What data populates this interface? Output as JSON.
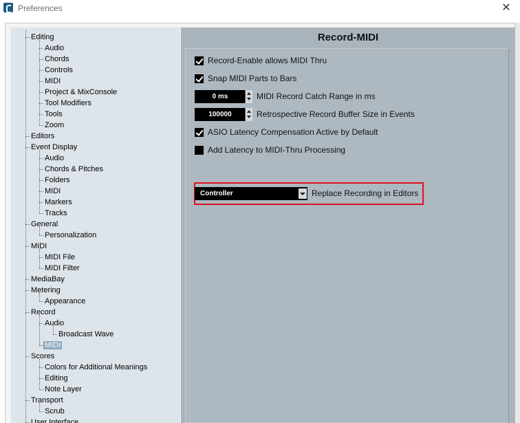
{
  "window": {
    "title": "Preferences"
  },
  "tree": [
    {
      "label": "Editing",
      "level": 0
    },
    {
      "label": "Audio",
      "level": 1
    },
    {
      "label": "Chords",
      "level": 1
    },
    {
      "label": "Controls",
      "level": 1
    },
    {
      "label": "MIDI",
      "level": 1
    },
    {
      "label": "Project & MixConsole",
      "level": 1
    },
    {
      "label": "Tool Modifiers",
      "level": 1
    },
    {
      "label": "Tools",
      "level": 1
    },
    {
      "label": "Zoom",
      "level": 1
    },
    {
      "label": "Editors",
      "level": 0
    },
    {
      "label": "Event Display",
      "level": 0
    },
    {
      "label": "Audio",
      "level": 1
    },
    {
      "label": "Chords & Pitches",
      "level": 1
    },
    {
      "label": "Folders",
      "level": 1
    },
    {
      "label": "MIDI",
      "level": 1
    },
    {
      "label": "Markers",
      "level": 1
    },
    {
      "label": "Tracks",
      "level": 1
    },
    {
      "label": "General",
      "level": 0
    },
    {
      "label": "Personalization",
      "level": 1
    },
    {
      "label": "MIDI",
      "level": 0
    },
    {
      "label": "MIDI File",
      "level": 1
    },
    {
      "label": "MIDI Filter",
      "level": 1
    },
    {
      "label": "MediaBay",
      "level": 0
    },
    {
      "label": "Metering",
      "level": 0
    },
    {
      "label": "Appearance",
      "level": 1
    },
    {
      "label": "Record",
      "level": 0
    },
    {
      "label": "Audio",
      "level": 1
    },
    {
      "label": "Broadcast Wave",
      "level": 2
    },
    {
      "label": "MIDI",
      "level": 1,
      "selected": true
    },
    {
      "label": "Scores",
      "level": 0
    },
    {
      "label": "Colors for Additional Meanings",
      "level": 1
    },
    {
      "label": "Editing",
      "level": 1
    },
    {
      "label": "Note Layer",
      "level": 1
    },
    {
      "label": "Transport",
      "level": 0
    },
    {
      "label": "Scrub",
      "level": 1
    },
    {
      "label": "User Interface",
      "level": 0
    }
  ],
  "panel": {
    "title": "Record-MIDI",
    "options": {
      "record_enable_midi_thru": {
        "label": "Record-Enable allows MIDI Thru",
        "checked": true
      },
      "snap_midi_parts": {
        "label": "Snap MIDI Parts to Bars",
        "checked": true
      },
      "catch_range": {
        "value": "0 ms",
        "label": "MIDI Record Catch Range in ms"
      },
      "retro_buffer": {
        "value": "100000",
        "label": "Retrospective Record Buffer Size in Events"
      },
      "asio_latency": {
        "label": "ASIO Latency Compensation Active by Default",
        "checked": true
      },
      "add_latency": {
        "label": "Add Latency to MIDI-Thru Processing",
        "checked": false
      },
      "replace_recording": {
        "value": "Controller",
        "label": "Replace Recording in Editors"
      }
    }
  },
  "colors": {
    "highlight": "#e0101e",
    "panel_bg": "#aab4bd",
    "tree_bg": "#dde4ea",
    "selected_bg": "#8fa8bf"
  }
}
